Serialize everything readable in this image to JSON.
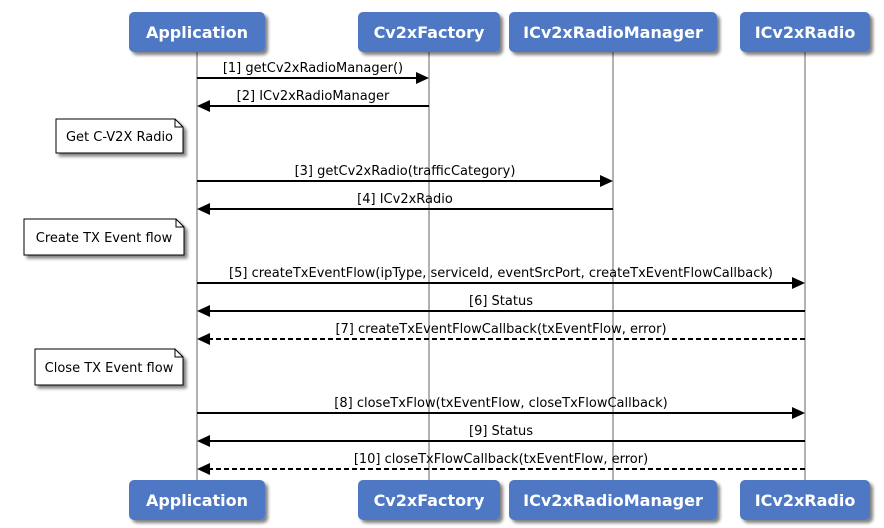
{
  "diagram": {
    "type": "sequence",
    "colors": {
      "actor_fill": "#4f78c4",
      "actor_text": "#ffffff",
      "lifeline": "#999999",
      "arrow": "#000000",
      "note_fill": "#ffffff"
    },
    "actors": [
      {
        "id": "app",
        "label": "Application"
      },
      {
        "id": "factory",
        "label": "Cv2xFactory"
      },
      {
        "id": "manager",
        "label": "ICv2xRadioManager"
      },
      {
        "id": "radio",
        "label": "ICv2xRadio"
      }
    ],
    "notes": [
      {
        "text": "Get C-V2X Radio",
        "before_message": 3
      },
      {
        "text": "Create TX Event flow",
        "before_message": 5
      },
      {
        "text": "Close TX Event flow",
        "before_message": 8
      }
    ],
    "messages": [
      {
        "n": 1,
        "from": "app",
        "to": "factory",
        "label": "[1] getCv2xRadioManager()",
        "style": "solid"
      },
      {
        "n": 2,
        "from": "factory",
        "to": "app",
        "label": "[2] ICv2xRadioManager",
        "style": "solid"
      },
      {
        "n": 3,
        "from": "app",
        "to": "manager",
        "label": "[3] getCv2xRadio(trafficCategory)",
        "style": "solid"
      },
      {
        "n": 4,
        "from": "manager",
        "to": "app",
        "label": "[4] ICv2xRadio",
        "style": "solid"
      },
      {
        "n": 5,
        "from": "app",
        "to": "radio",
        "label": "[5] createTxEventFlow(ipType, serviceId, eventSrcPort, createTxEventFlowCallback)",
        "style": "solid"
      },
      {
        "n": 6,
        "from": "radio",
        "to": "app",
        "label": "[6] Status",
        "style": "solid"
      },
      {
        "n": 7,
        "from": "radio",
        "to": "app",
        "label": "[7] createTxEventFlowCallback(txEventFlow, error)",
        "style": "dashed"
      },
      {
        "n": 8,
        "from": "app",
        "to": "radio",
        "label": "[8] closeTxFlow(txEventFlow, closeTxFlowCallback)",
        "style": "solid"
      },
      {
        "n": 9,
        "from": "radio",
        "to": "app",
        "label": "[9] Status",
        "style": "solid"
      },
      {
        "n": 10,
        "from": "radio",
        "to": "app",
        "label": "[10] closeTxFlowCallback(txEventFlow, error)",
        "style": "dashed"
      }
    ]
  }
}
